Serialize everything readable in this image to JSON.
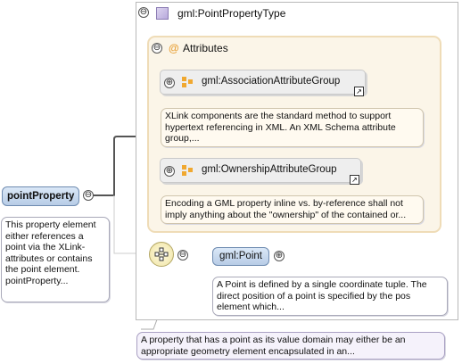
{
  "type": {
    "name": "gml:PointPropertyType",
    "collapse_symbol": "⊖"
  },
  "attributes": {
    "title": "Attributes",
    "symbol": "@",
    "collapse_symbol": "⊖"
  },
  "groups": [
    {
      "name": "gml:AssociationAttributeGroup",
      "expand_symbol": "⊕",
      "ref_symbol": "↗",
      "doc": "XLink components are the standard method to support hypertext referencing in XML. An XML Schema attribute group,..."
    },
    {
      "name": "gml:OwnershipAttributeGroup",
      "expand_symbol": "⊕",
      "ref_symbol": "↗",
      "doc": "Encoding a GML property inline vs. by-reference shall not imply anything about the \"ownership\" of the contained or..."
    }
  ],
  "element": {
    "name": "pointProperty",
    "collapse_symbol": "⊖",
    "doc": "This property element either references a point via the XLink-attributes or contains the point element. pointProperty..."
  },
  "sequence": {
    "icon": "sequence-compositor-icon",
    "collapse_symbol": "⊖"
  },
  "point": {
    "name": "gml:Point",
    "expand_symbol": "⊕",
    "doc": "A Point is defined by a single coordinate tuple. The direct position of a point is specified by the pos element which..."
  },
  "type_doc": "A property that has a point as its value domain may either be an appropriate geometry element encapsulated in an...",
  "colors": {
    "element_fill": "#c6d7ee",
    "attr_fill": "#fbf5e8",
    "group_fill": "#eeeeee",
    "doc_fill": "#ffffff",
    "type_icon": "#b8a9dc",
    "attr_icon": "#f0a830"
  }
}
